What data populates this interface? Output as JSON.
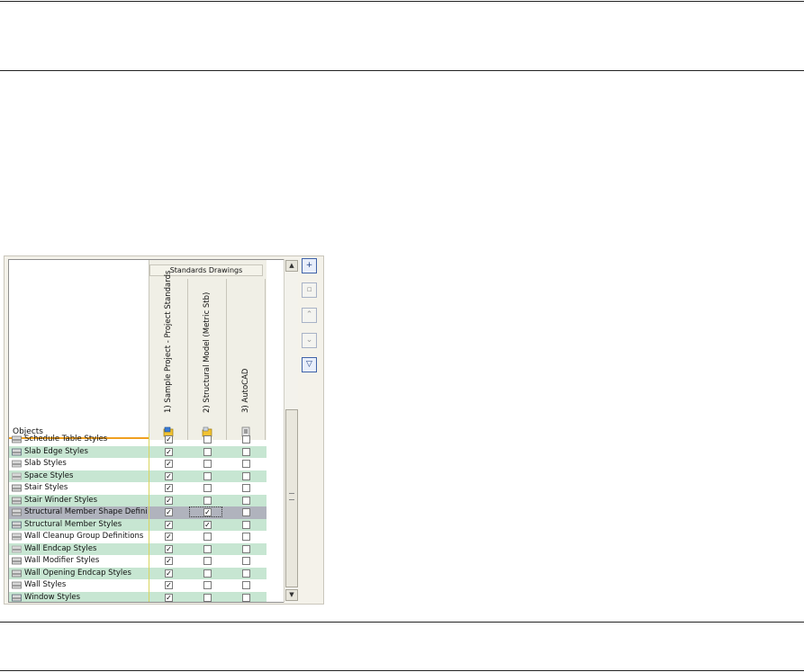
{
  "dialog": {
    "standards_drawings_label": "Standards Drawings",
    "objects_label": "Objects",
    "columns": [
      {
        "label": "1) Sample Project - Project Standards",
        "icon": "project-standards-icon"
      },
      {
        "label": "2) Structural Model (Metric Stb)",
        "icon": "folder-drawing-icon"
      },
      {
        "label": "3) AutoCAD",
        "icon": "autocad-drawing-icon"
      }
    ],
    "rows": [
      {
        "label": "Schedule Table Styles",
        "icon": "schedule-table-icon",
        "checks": [
          true,
          false,
          false
        ]
      },
      {
        "label": "Slab Edge Styles",
        "icon": "slab-edge-icon",
        "checks": [
          true,
          false,
          false
        ]
      },
      {
        "label": "Slab Styles",
        "icon": "slab-icon",
        "checks": [
          true,
          false,
          false
        ]
      },
      {
        "label": "Space Styles",
        "icon": "space-icon",
        "checks": [
          true,
          false,
          false
        ]
      },
      {
        "label": "Stair Styles",
        "icon": "stair-icon",
        "checks": [
          true,
          false,
          false
        ]
      },
      {
        "label": "Stair Winder Styles",
        "icon": "stair-winder-icon",
        "checks": [
          true,
          false,
          false
        ]
      },
      {
        "label": "Structural Member Shape Definit...",
        "icon": "member-shape-icon",
        "checks": [
          true,
          true,
          false
        ]
      },
      {
        "label": "Structural Member Styles",
        "icon": "member-style-icon",
        "checks": [
          true,
          true,
          false
        ]
      },
      {
        "label": "Wall Cleanup Group Definitions",
        "icon": "wall-cleanup-icon",
        "checks": [
          true,
          false,
          false
        ]
      },
      {
        "label": "Wall Endcap Styles",
        "icon": "wall-endcap-icon",
        "checks": [
          true,
          false,
          false
        ]
      },
      {
        "label": "Wall Modifier Styles",
        "icon": "wall-modifier-icon",
        "checks": [
          true,
          false,
          false
        ]
      },
      {
        "label": "Wall Opening Endcap Styles",
        "icon": "wall-opening-endcap-icon",
        "checks": [
          true,
          false,
          false
        ]
      },
      {
        "label": "Wall Styles",
        "icon": "wall-style-icon",
        "checks": [
          true,
          false,
          false
        ]
      },
      {
        "label": "Window Styles",
        "icon": "window-style-icon",
        "checks": [
          true,
          false,
          false
        ]
      }
    ],
    "selected_row": 6,
    "side_buttons": [
      {
        "name": "add-drawing-button",
        "icon": "add-drawing-icon",
        "enabled": true
      },
      {
        "name": "remove-drawing-button",
        "icon": "remove-drawing-icon",
        "enabled": false
      },
      {
        "name": "move-up-button",
        "icon": "move-up-icon",
        "enabled": false
      },
      {
        "name": "move-down-button",
        "icon": "move-down-icon",
        "enabled": false
      },
      {
        "name": "filter-button",
        "icon": "filter-icon",
        "enabled": true
      }
    ],
    "colors": {
      "row_alt": "#c7e6d2",
      "row_selected": "#b0b3bd",
      "objects_underline": "#f0a020"
    }
  }
}
